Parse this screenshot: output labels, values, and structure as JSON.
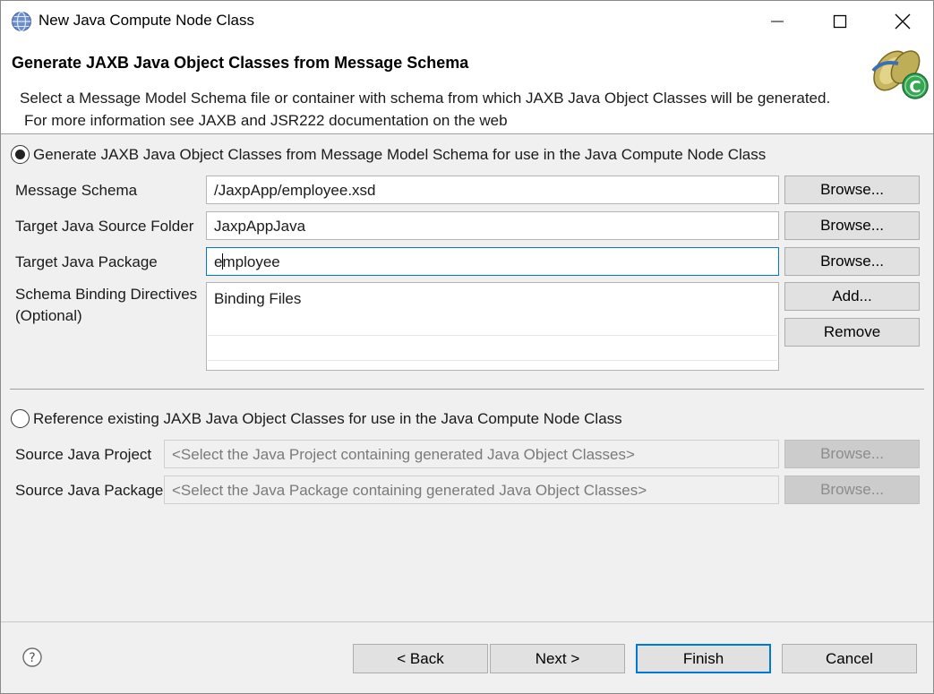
{
  "window": {
    "title": "New Java Compute Node Class",
    "minimize_icon": "minimize-icon",
    "maximize_icon": "maximize-icon",
    "close_icon": "close-icon"
  },
  "banner": {
    "title": "Generate JAXB Java Object Classes from Message Schema",
    "description_line1": "Select a Message Model Schema file or container with schema from which JAXB Java Object Classes will be generated.",
    "description_line2": "For more information see JAXB and JSR222 documentation on the web",
    "logo_icon": "java-compute-wizard-icon"
  },
  "generate_section": {
    "radio_label": "Generate JAXB Java Object Classes from Message Model Schema for use in the Java Compute Node Class",
    "selected": true,
    "message_schema": {
      "label": "Message Schema",
      "value": "/JaxpApp/employee.xsd",
      "button": "Browse..."
    },
    "target_source_folder": {
      "label": "Target Java Source Folder",
      "value": "JaxpAppJava",
      "button": "Browse..."
    },
    "target_package": {
      "label": "Target Java Package",
      "value_before_caret": "e",
      "value_after_caret": "mployee",
      "button": "Browse..."
    },
    "binding_directives": {
      "label_line1": "Schema Binding Directives",
      "label_line2": "(Optional)",
      "list_header": "Binding Files",
      "add_button": "Add...",
      "remove_button": "Remove"
    }
  },
  "reference_section": {
    "radio_label": "Reference existing JAXB Java Object Classes for use in the Java Compute Node Class",
    "selected": false,
    "source_project": {
      "label": "Source Java Project",
      "placeholder": "<Select the Java Project containing generated Java Object Classes>",
      "button": "Browse..."
    },
    "source_package": {
      "label": "Source Java Package",
      "placeholder": "<Select the Java Package containing generated Java Object Classes>",
      "button": "Browse..."
    }
  },
  "footer": {
    "help_icon": "help-icon",
    "back": "< Back",
    "next": "Next >",
    "finish": "Finish",
    "cancel": "Cancel"
  },
  "colors": {
    "accent": "#0078d7",
    "window_bg": "#f0f0f0",
    "button_bg": "#e1e1e1",
    "disabled_button_bg": "#cccccc"
  }
}
